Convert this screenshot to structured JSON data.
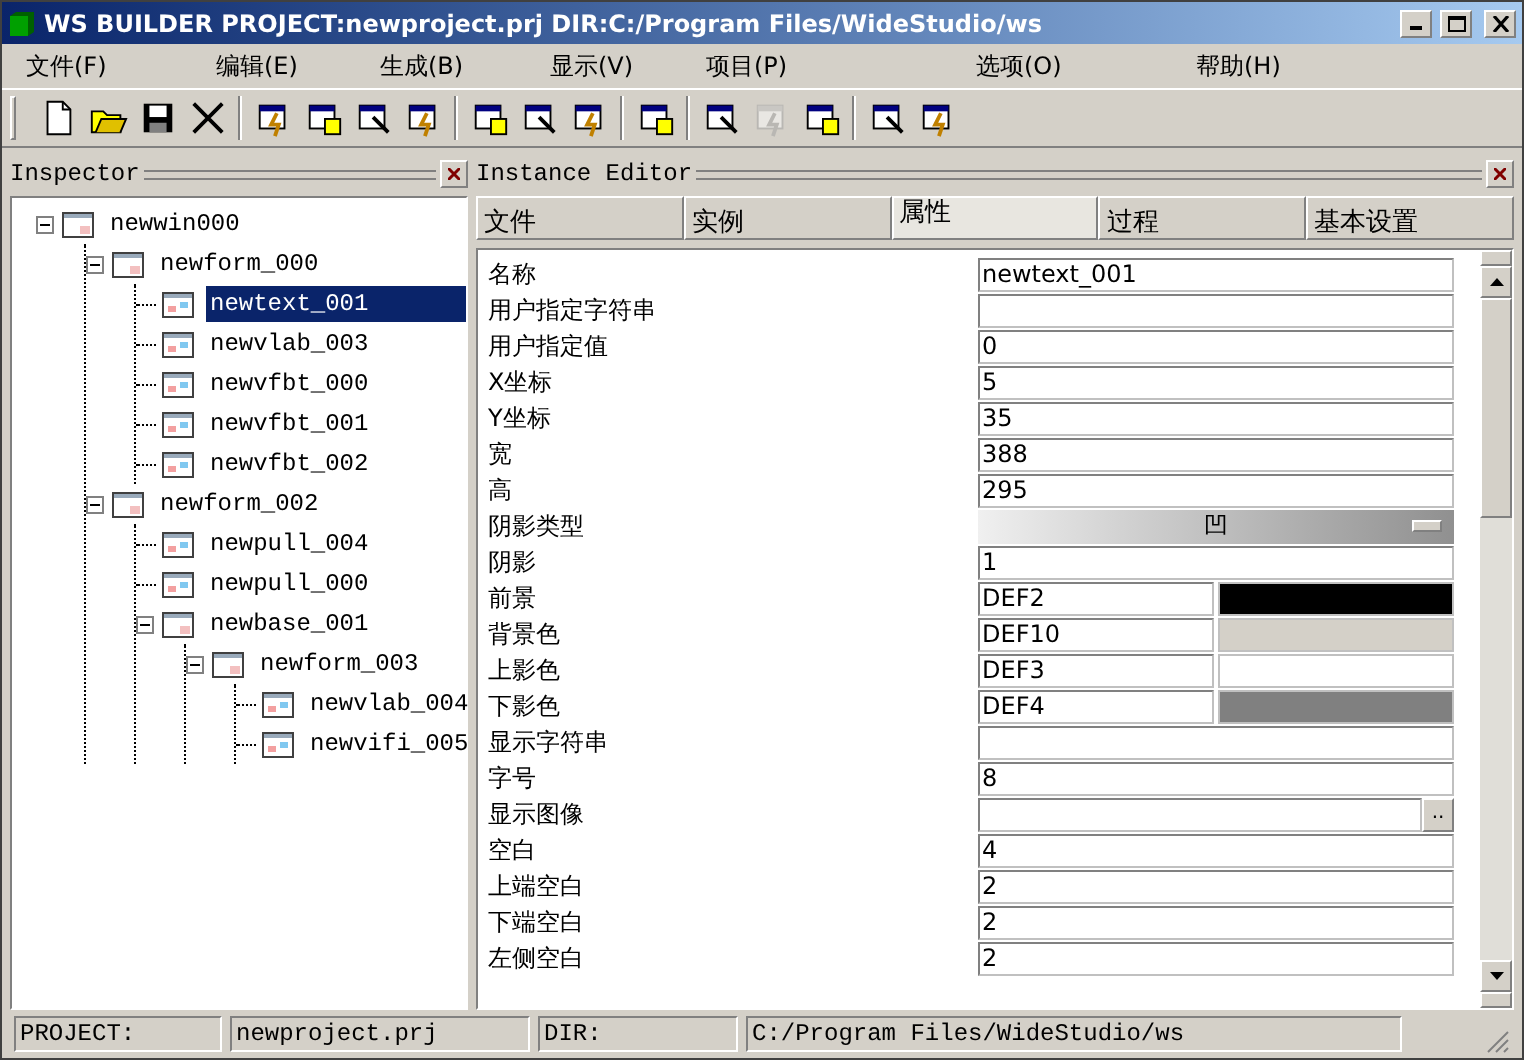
{
  "window": {
    "title": "WS BUILDER PROJECT:newproject.prj DIR:C:/Program Files/WideStudio/ws"
  },
  "menu": [
    {
      "label": "文件(F)"
    },
    {
      "label": "编辑(E)"
    },
    {
      "label": "生成(B)"
    },
    {
      "label": "显示(V)"
    },
    {
      "label": "项目(P)"
    },
    {
      "label": "选项(O)"
    },
    {
      "label": "帮助(H)"
    }
  ],
  "toolbar": [
    [
      {
        "disabled": false
      },
      {
        "disabled": false
      },
      {
        "disabled": false
      },
      {
        "disabled": false
      }
    ],
    [
      {
        "disabled": false
      },
      {
        "disabled": false
      },
      {
        "disabled": false
      },
      {
        "disabled": false
      }
    ],
    [
      {
        "disabled": false
      },
      {
        "disabled": false
      },
      {
        "disabled": false
      }
    ],
    [
      {
        "disabled": false
      }
    ],
    [
      {
        "disabled": false
      },
      {
        "disabled": true
      },
      {
        "disabled": false
      }
    ],
    [
      {
        "disabled": false
      },
      {
        "disabled": false
      }
    ]
  ],
  "inspector": {
    "title": "Inspector",
    "tree": [
      {
        "label": "newwin000",
        "selected": false,
        "expanded": true,
        "children": [
          {
            "label": "newform_000",
            "selected": false,
            "expanded": true,
            "children": [
              {
                "label": "newtext_001",
                "selected": true
              },
              {
                "label": "newvlab_003",
                "selected": false
              },
              {
                "label": "newvfbt_000",
                "selected": false
              },
              {
                "label": "newvfbt_001",
                "selected": false
              },
              {
                "label": "newvfbt_002",
                "selected": false
              }
            ]
          },
          {
            "label": "newform_002",
            "selected": false,
            "expanded": true,
            "children": [
              {
                "label": "newpull_004",
                "selected": false
              },
              {
                "label": "newpull_000",
                "selected": false
              },
              {
                "label": "newbase_001",
                "selected": false,
                "expanded": true,
                "children": [
                  {
                    "label": "newform_003",
                    "selected": false,
                    "expanded": true,
                    "children": [
                      {
                        "label": "newvlab_004",
                        "selected": false
                      },
                      {
                        "label": "newvifi_005",
                        "selected": false
                      }
                    ]
                  }
                ]
              }
            ]
          }
        ]
      }
    ]
  },
  "editor": {
    "title": "Instance Editor",
    "tabs": [
      {
        "label": "文件",
        "selected": false
      },
      {
        "label": "实例",
        "selected": false
      },
      {
        "label": "属性",
        "selected": true
      },
      {
        "label": "过程",
        "selected": false
      },
      {
        "label": "基本设置",
        "selected": false
      }
    ],
    "properties": [
      {
        "kind": "text",
        "label": "名称",
        "value": "newtext_001"
      },
      {
        "kind": "text",
        "label": "用户指定字符串"
      },
      {
        "kind": "text",
        "label": "用户指定值",
        "value": "0"
      },
      {
        "kind": "text",
        "label": "X坐标",
        "value": "5"
      },
      {
        "kind": "text",
        "label": "Y坐标",
        "value": "35"
      },
      {
        "kind": "text",
        "label": "宽",
        "value": "388"
      },
      {
        "kind": "text",
        "label": "高",
        "value": "295"
      },
      {
        "kind": "dropdown",
        "label": "阴影类型",
        "value": "凹"
      },
      {
        "kind": "text",
        "label": "阴影",
        "value": "1"
      },
      {
        "kind": "color",
        "label": "前景",
        "value": "DEF2",
        "color": "#000000"
      },
      {
        "kind": "color",
        "label": "背景色",
        "value": "DEF10",
        "color": "#d4d0c8"
      },
      {
        "kind": "color",
        "label": "上影色",
        "value": "DEF3",
        "color": "#ffffff"
      },
      {
        "kind": "color",
        "label": "下影色",
        "value": "DEF4",
        "color": "#808080"
      },
      {
        "kind": "text",
        "label": "显示字符串"
      },
      {
        "kind": "text",
        "label": "字号",
        "value": "8"
      },
      {
        "kind": "file",
        "label": "显示图像",
        "button": ".."
      },
      {
        "kind": "text",
        "label": "空白",
        "value": "4"
      },
      {
        "kind": "text",
        "label": "上端空白",
        "value": "2"
      },
      {
        "kind": "text",
        "label": "下端空白",
        "value": "2"
      },
      {
        "kind": "text",
        "label": "左侧空白",
        "value": "2"
      }
    ]
  },
  "status_bar": [
    {
      "text": "PROJECT:"
    },
    {
      "text": "newproject.prj"
    },
    {
      "text": "DIR:"
    },
    {
      "text": "C:/Program Files/WideStudio/ws"
    }
  ]
}
